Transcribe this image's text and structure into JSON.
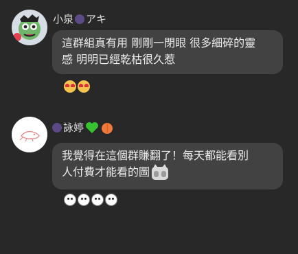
{
  "messages": [
    {
      "sender": "小泉",
      "sender_suffix": "アキ",
      "text_line1": "這群組真有用 剛剛一閉眼 很多細碎的靈",
      "text_line2": "感 明明已經乾枯很久惹",
      "reactions": [
        "heart-eyes-emoji",
        "heart-eyes-emoji"
      ]
    },
    {
      "sender": "詠婷",
      "sender_badges": [
        "green-heart-icon",
        "peach-icon"
      ],
      "text_line1": "我覺得在這個群賺翻了！每天都能看別",
      "text_line2": "人付費才能看的圖",
      "inline_sticker": "shy-cat-sticker",
      "reactions": [
        "white-face-emoji",
        "white-face-emoji",
        "white-face-emoji",
        "white-face-emoji"
      ]
    }
  ],
  "colors": {
    "background": "#282828",
    "bubble": "#424242",
    "text": "#ececec",
    "name": "#dedede"
  }
}
